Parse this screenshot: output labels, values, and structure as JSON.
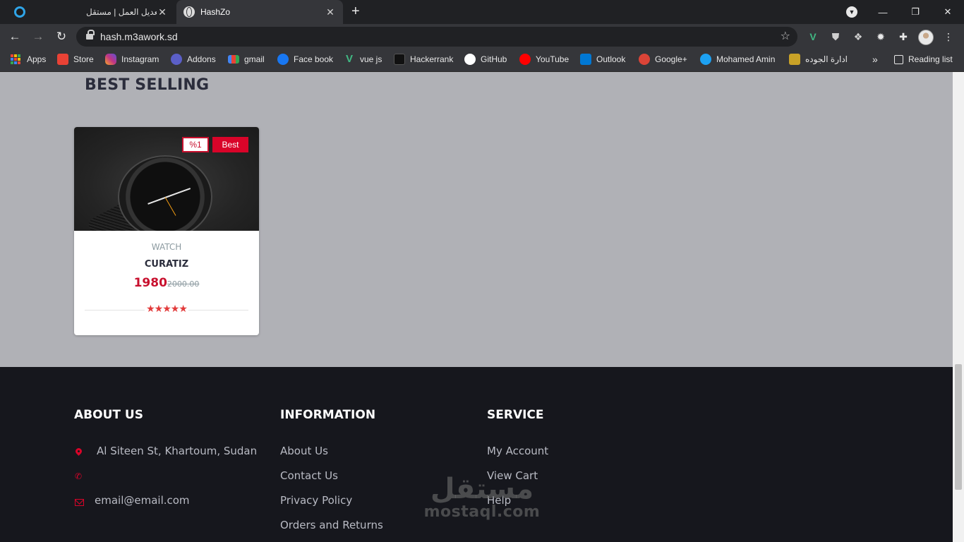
{
  "browser": {
    "tabs": [
      {
        "title": "تعديل العمل | مستقل",
        "close": "✕"
      },
      {
        "title": "HashZo",
        "close": "✕"
      }
    ],
    "new_tab": "+",
    "url": "hash.m3awork.sd",
    "bookmarks": [
      {
        "label": "Apps",
        "icon": "apps-grid-icon"
      },
      {
        "label": "Store",
        "icon": "store-icon",
        "color": "#e94235"
      },
      {
        "label": "Instagram",
        "icon": "instagram-icon",
        "color": "#c13584"
      },
      {
        "label": "Addons",
        "icon": "addons-icon",
        "color": "#5b5fc7"
      },
      {
        "label": "gmail",
        "icon": "gmail-icon",
        "color": "#ea4335"
      },
      {
        "label": "Face book",
        "icon": "facebook-icon",
        "color": "#1877f2"
      },
      {
        "label": "vue js",
        "icon": "vue-icon",
        "color": "#41b883"
      },
      {
        "label": "Hackerrank",
        "icon": "hackerrank-icon",
        "color": "#111111"
      },
      {
        "label": "GitHub",
        "icon": "github-icon",
        "color": "#ffffff"
      },
      {
        "label": "YouTube",
        "icon": "youtube-icon",
        "color": "#ff0000"
      },
      {
        "label": "Outlook",
        "icon": "outlook-icon",
        "color": "#0078d4"
      },
      {
        "label": "Google+",
        "icon": "google-plus-icon",
        "color": "#db4437"
      },
      {
        "label": "Mohamed Amin",
        "icon": "twitter-icon",
        "color": "#1da1f2"
      },
      {
        "label": "ادارة الجوده",
        "icon": "quality-icon",
        "color": "#c9a227"
      }
    ],
    "more": "»",
    "reading_list": "Reading list"
  },
  "page": {
    "section_title": "BEST SELLING",
    "product": {
      "badge_discount": "%1",
      "badge_label": "Best",
      "category": "WATCH",
      "name": "CURATIZ",
      "price": "1980",
      "old_price": "2000.00",
      "rating": "★★★★★",
      "rating_value": 5,
      "rating_max": 5
    }
  },
  "footer": {
    "about": {
      "title": "ABOUT US",
      "address": "Al Siteen St, Khartoum, Sudan",
      "phone": "",
      "email": "email@email.com"
    },
    "information": {
      "title": "INFORMATION",
      "links": [
        "About Us",
        "Contact Us",
        "Privacy Policy",
        "Orders and Returns"
      ]
    },
    "service": {
      "title": "SERVICE",
      "links": [
        "My Account",
        "View Cart",
        "Help"
      ]
    }
  },
  "watermark": {
    "arabic": "مستقل",
    "latin": "mostaql.com"
  },
  "colors": {
    "accent": "#d90429",
    "footer_bg": "#16171d",
    "page_bg": "#b0b1b6"
  }
}
